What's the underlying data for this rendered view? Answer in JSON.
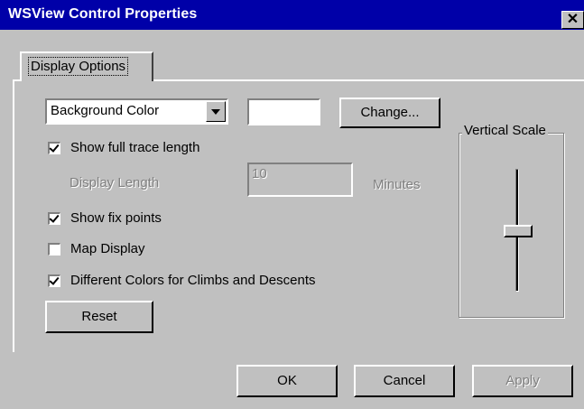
{
  "window": {
    "title": "WSView Control Properties",
    "close_glyph": "✕"
  },
  "tabs": [
    {
      "label": "Display Options",
      "selected": true
    }
  ],
  "color_select": {
    "value": "Background Color",
    "swatch_color": "#ffffff"
  },
  "change_button": {
    "label": "Change..."
  },
  "show_full_trace": {
    "label": "Show full trace length",
    "checked": true
  },
  "display_length": {
    "label": "Display Length",
    "value": "10",
    "unit": "Minutes"
  },
  "show_fix_points": {
    "label": "Show fix points",
    "checked": true
  },
  "map_display": {
    "label": "Map Display",
    "checked": false
  },
  "different_colors": {
    "label": "Different Colors for Climbs and Descents",
    "checked": true
  },
  "reset_button": {
    "label": "Reset"
  },
  "vertical_scale": {
    "title": "Vertical Scale",
    "level_fraction": 0.5
  },
  "footer": {
    "ok_label": "OK",
    "cancel_label": "Cancel",
    "apply_label": "Apply"
  },
  "colors": {
    "titlebar": "#0000a8",
    "face": "#c0c0c0",
    "disabled_text": "#808080"
  }
}
